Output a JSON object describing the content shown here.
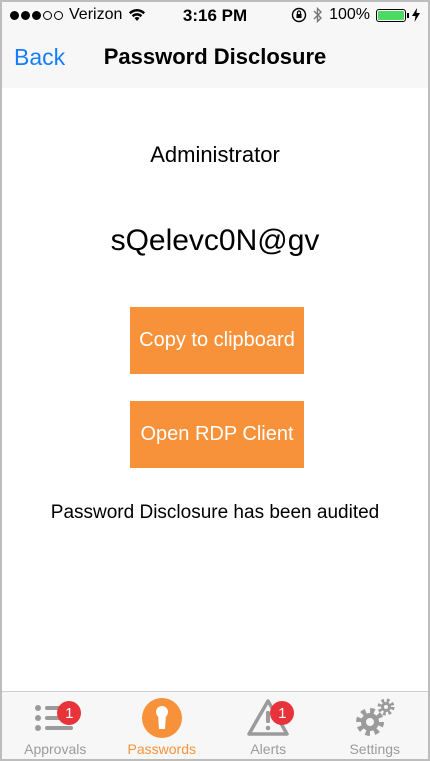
{
  "status_bar": {
    "carrier": "Verizon",
    "time": "3:16 PM",
    "battery": "100%"
  },
  "nav": {
    "back_label": "Back",
    "title": "Password Disclosure"
  },
  "main": {
    "account_name": "Administrator",
    "password": "sQelevc0N@gv",
    "copy_button_label": "Copy to clipboard",
    "rdp_button_label": "Open RDP Client",
    "audit_message": "Password Disclosure has been audited"
  },
  "tabs": [
    {
      "label": "Approvals",
      "icon": "list-icon",
      "badge": "1"
    },
    {
      "label": "Passwords",
      "icon": "keyhole-icon",
      "badge": ""
    },
    {
      "label": "Alerts",
      "icon": "warning-icon",
      "badge": "1"
    },
    {
      "label": "Settings",
      "icon": "gear-icon",
      "badge": ""
    }
  ],
  "colors": {
    "accent": "#f7923a",
    "link": "#147efb",
    "badge": "#e8333a",
    "battery": "#4cd964"
  }
}
